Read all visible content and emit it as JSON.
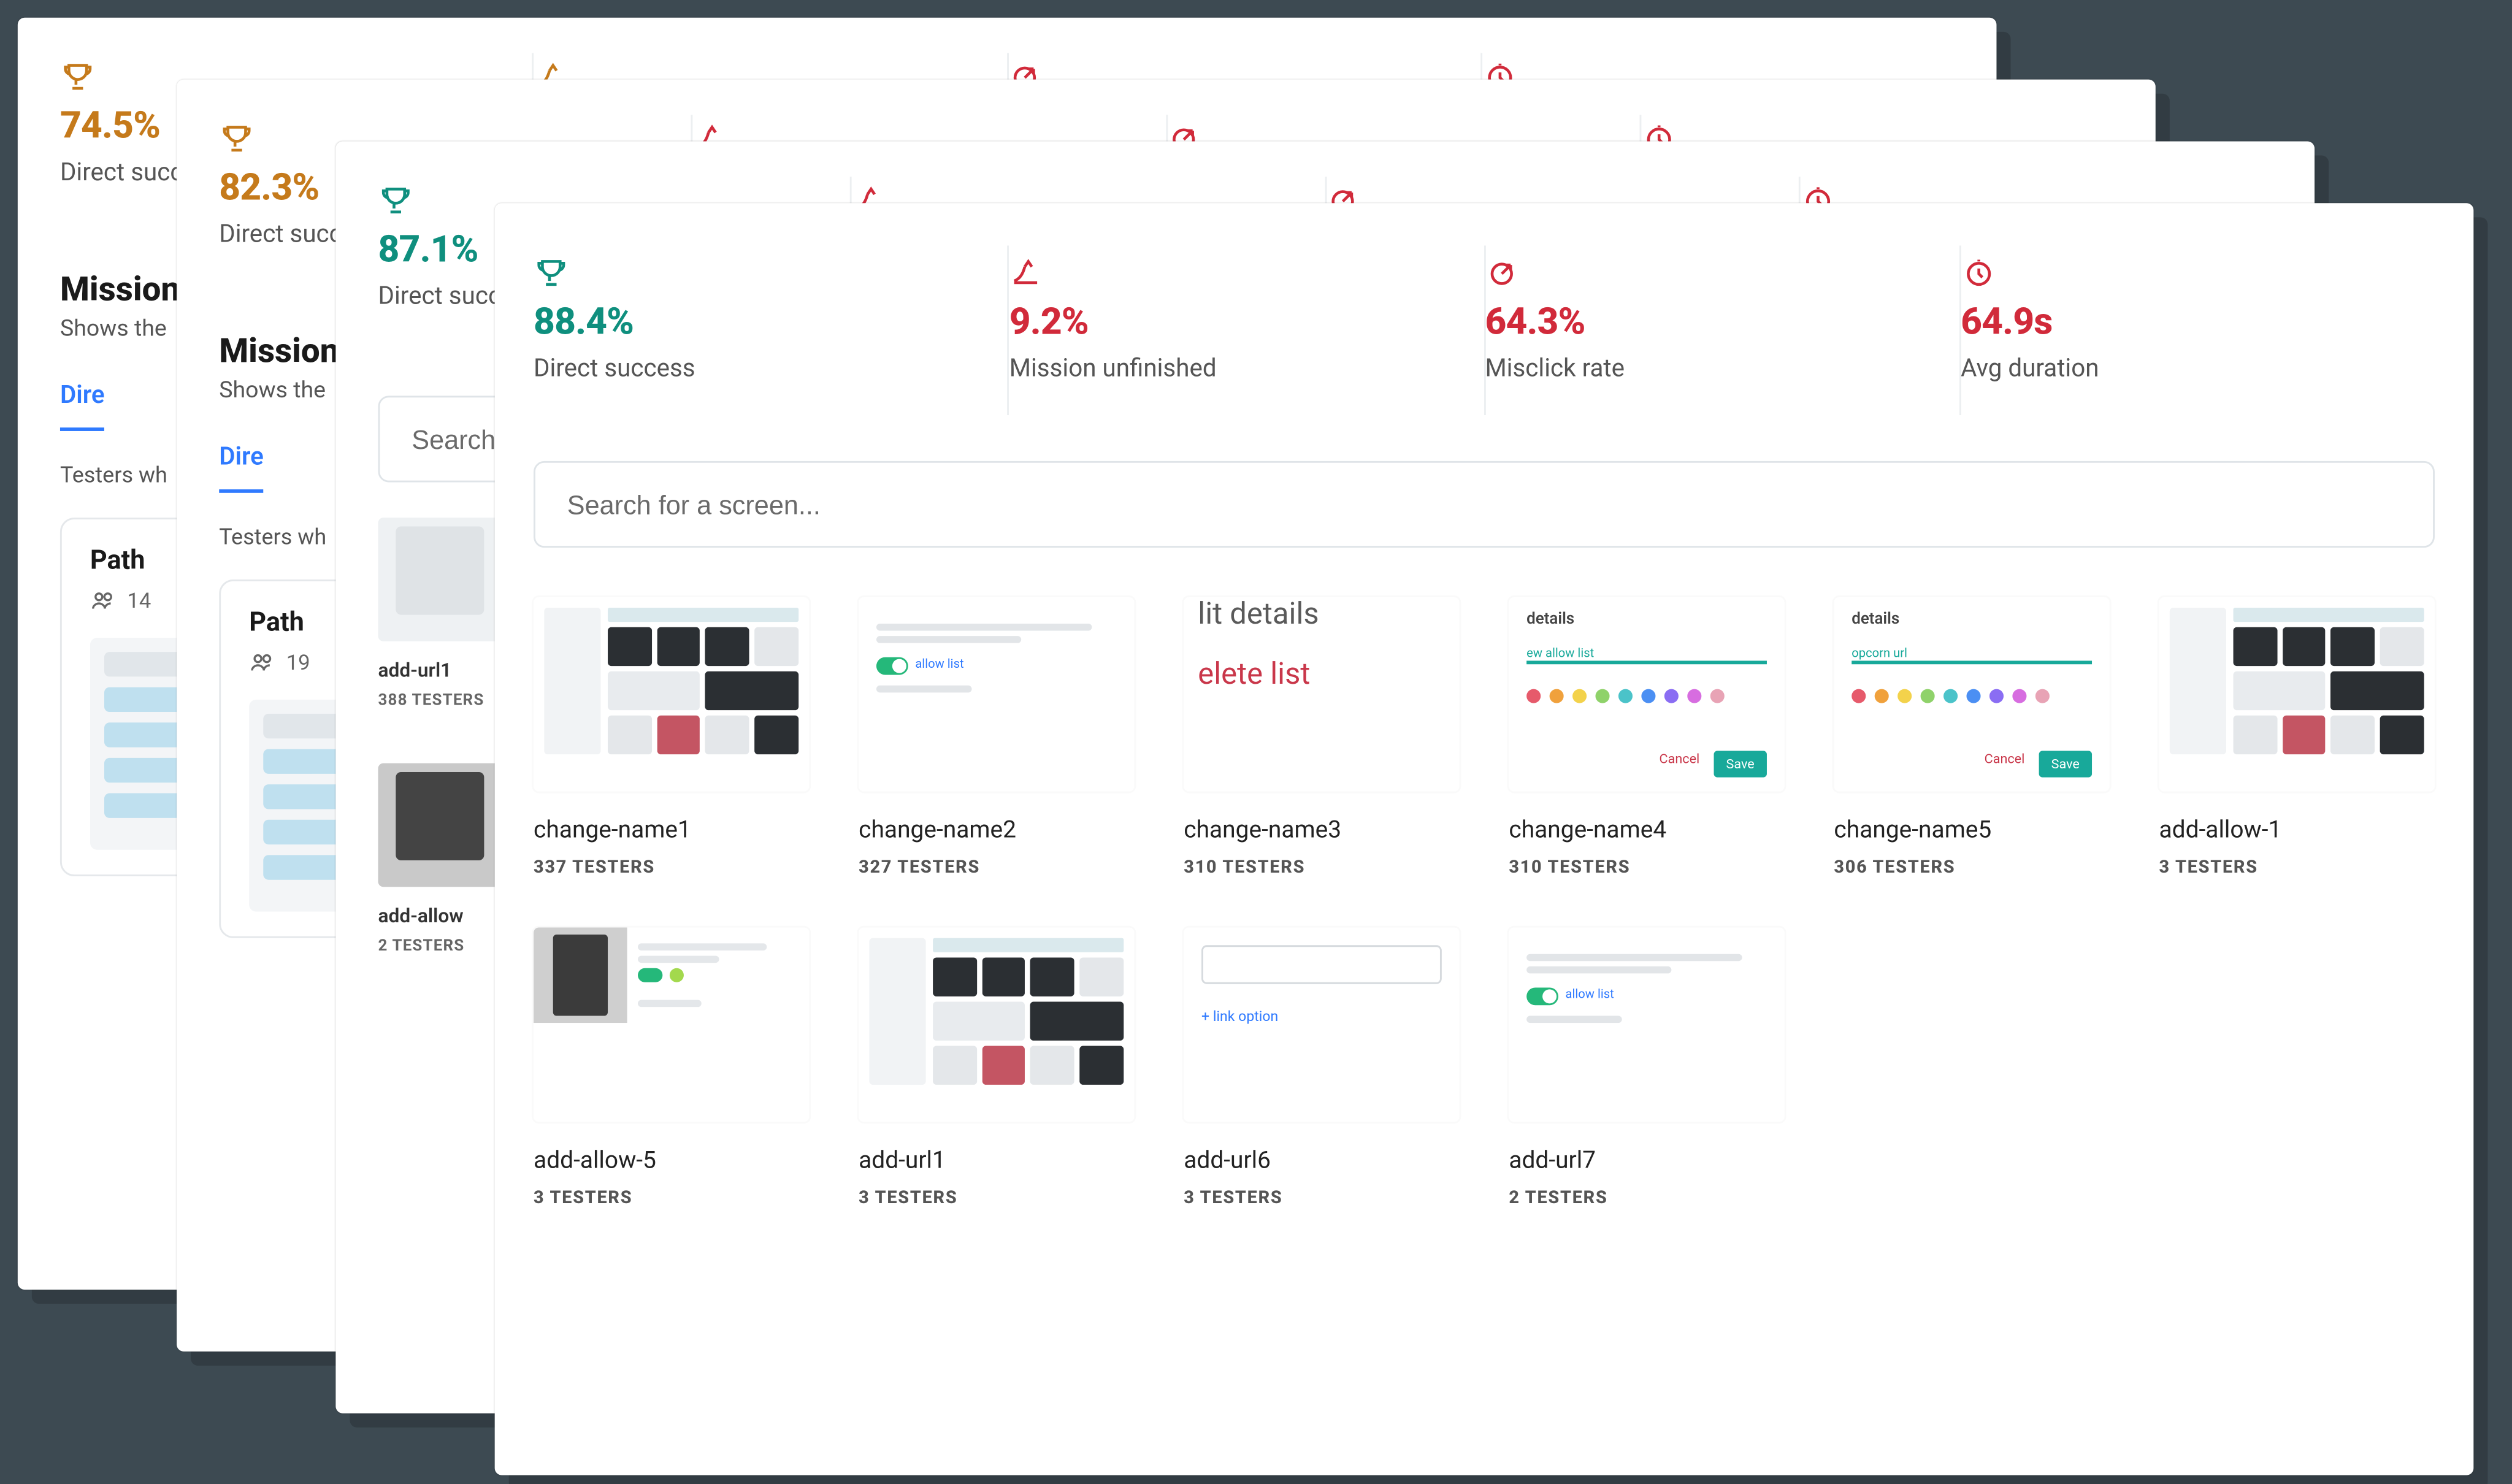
{
  "colors": {
    "teal": "#0f8f7e",
    "brown": "#c57a1b",
    "red": "#d12a3a"
  },
  "back_windows": [
    {
      "direct_success": "74.5%",
      "mission_title": "Mission p",
      "mission_sub": "Shows the",
      "tab_label": "Dire",
      "testers_line": "Testers wh",
      "path_name": "Path",
      "path_count": "14"
    },
    {
      "direct_success": "82.3%",
      "mission_title": "Mission p",
      "mission_sub": "Shows the",
      "tab_label": "Dire",
      "testers_line": "Testers wh",
      "path_name": "Path",
      "path_count": "19"
    },
    {
      "direct_success": "87.1%",
      "search_placeholder": "Search",
      "cards": [
        {
          "name": "add-url1",
          "count": "388 TESTERS"
        },
        {
          "name": "add-allow",
          "count": "2 TESTERS"
        }
      ]
    }
  ],
  "front": {
    "metrics": [
      {
        "key": "direct_success",
        "value": "88.4%",
        "label": "Direct success",
        "color": "teal",
        "icon": "trophy"
      },
      {
        "key": "mission_unfinished",
        "value": "9.2%",
        "label": "Mission unfinished",
        "color": "red",
        "icon": "bounce"
      },
      {
        "key": "misclick_rate",
        "value": "64.3%",
        "label": "Misclick rate",
        "color": "red",
        "icon": "target"
      },
      {
        "key": "avg_duration",
        "value": "64.9s",
        "label": "Avg duration",
        "color": "red",
        "icon": "clock"
      }
    ],
    "search_placeholder": "Search for a screen...",
    "screens": [
      {
        "name": "change-name1",
        "count": "337 TESTERS",
        "thumb": "dash"
      },
      {
        "name": "change-name2",
        "count": "327 TESTERS",
        "thumb": "toggle"
      },
      {
        "name": "change-name3",
        "count": "310 TESTERS",
        "thumb": "text"
      },
      {
        "name": "change-name4",
        "count": "310 TESTERS",
        "thumb": "modal-a"
      },
      {
        "name": "change-name5",
        "count": "306 TESTERS",
        "thumb": "modal-b"
      },
      {
        "name": "add-allow-1",
        "count": "3 TESTERS",
        "thumb": "dash"
      },
      {
        "name": "add-allow-5",
        "count": "3 TESTERS",
        "thumb": "dark"
      },
      {
        "name": "add-url1",
        "count": "3 TESTERS",
        "thumb": "dash"
      },
      {
        "name": "add-url6",
        "count": "3 TESTERS",
        "thumb": "input"
      },
      {
        "name": "add-url7",
        "count": "2 TESTERS",
        "thumb": "toggle"
      }
    ],
    "thumb_strings": {
      "text_t1": "lit details",
      "text_t2": "elete list",
      "modal_a_title": "details",
      "modal_a_input": "ew allow list",
      "modal_b_title": "details",
      "modal_b_input": "opcorn url",
      "modal_cancel": "Cancel",
      "modal_save": "Save",
      "input_link": "+ link option"
    }
  },
  "labels": {
    "direct_success": "Direct succ"
  }
}
